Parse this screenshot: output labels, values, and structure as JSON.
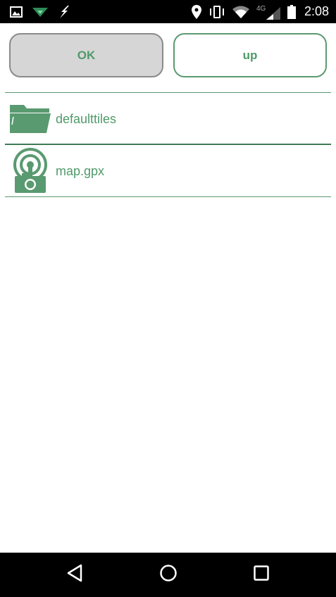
{
  "status_bar": {
    "left_icons": [
      "image-icon",
      "wifi-download-icon",
      "lightning-icon"
    ],
    "right_icons": [
      "location-pin-icon",
      "vibrate-icon",
      "wifi-icon",
      "lte-signal-icon",
      "battery-icon"
    ],
    "network_label": "4G",
    "time": "2:08"
  },
  "buttons": {
    "ok_label": "OK",
    "up_label": "up"
  },
  "files": [
    {
      "name": "defaulttiles",
      "icon": "folder-icon"
    },
    {
      "name": "map.gpx",
      "icon": "gpx-file-icon"
    }
  ],
  "colors": {
    "accent": "#4f9a6a",
    "divider": "#5a9a70",
    "ok_bg": "#d6d6d6",
    "status_bar": "#000000"
  },
  "nav_bar": {
    "icons": [
      "back-icon",
      "home-icon",
      "recents-icon"
    ]
  }
}
